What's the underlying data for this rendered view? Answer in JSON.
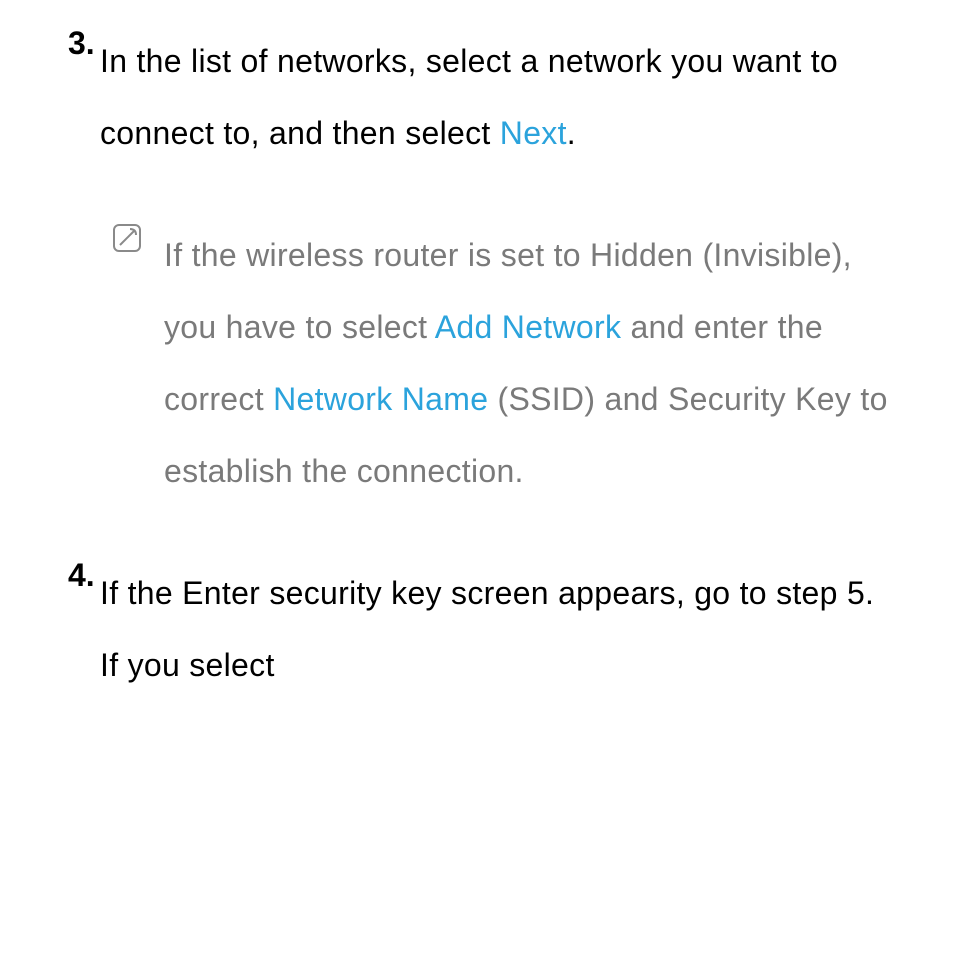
{
  "step3": {
    "number": "3.",
    "text_part1": "In the list of networks, select a network you want to connect to, and then select ",
    "link_next": "Next",
    "text_part2": "."
  },
  "note": {
    "text_part1": "If the wireless router is set to Hidden (Invisible), you have to select ",
    "link_add_network": "Add Network",
    "text_part2": " and enter the correct ",
    "link_network_name": "Network Name",
    "text_part3": " (SSID) and Security Key to establish the connection."
  },
  "step4": {
    "number": "4.",
    "text": "If the Enter security key screen appears, go to step 5. If you select"
  }
}
